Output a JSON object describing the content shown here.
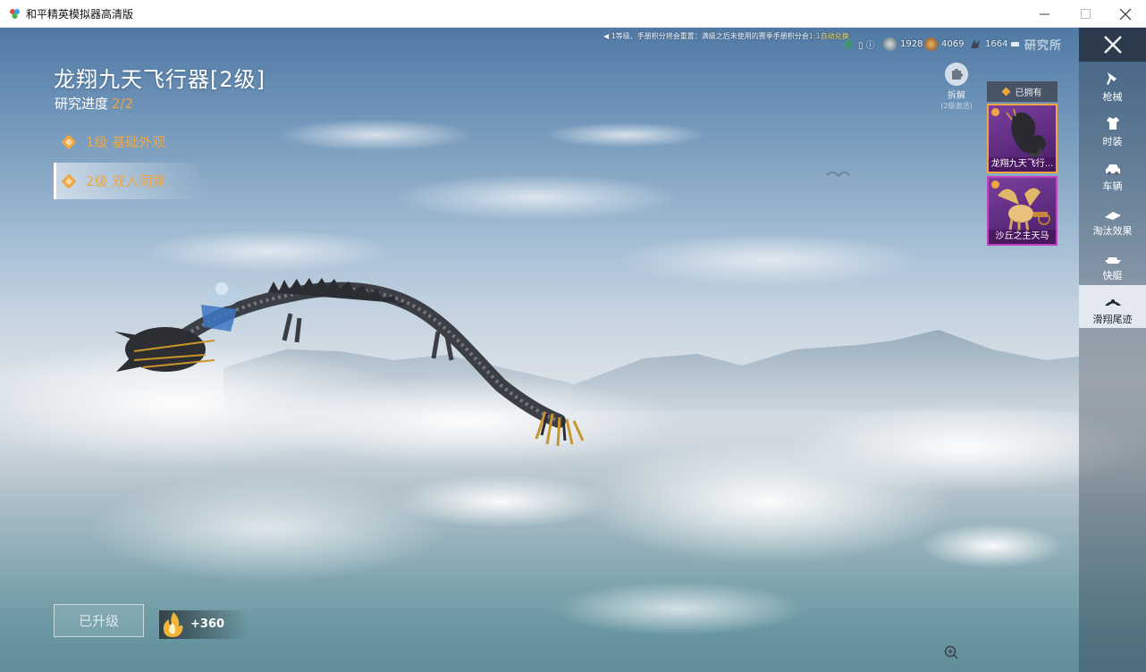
{
  "window": {
    "title": "和平精英模拟器高清版",
    "controls": [
      "minimize",
      "maximize",
      "close"
    ]
  },
  "notice": {
    "text": "1等级、手册积分将会重置：满级之后未使用的赛季手册积分会",
    "highlight": "1:1自动兑换"
  },
  "currency": {
    "items": [
      {
        "icon": "coin-green-icon",
        "value": ""
      },
      {
        "icon": "silver-coin-icon",
        "value": "1928"
      },
      {
        "icon": "bronze-coin-icon",
        "value": "4069"
      },
      {
        "icon": "fragment-icon",
        "value": "1664"
      }
    ],
    "lab_label": "研究所"
  },
  "item": {
    "title": "龙翔九天飞行器[2级]",
    "progress_label": "研究进度",
    "progress_value": "2/2"
  },
  "levels": [
    {
      "label": "1级 基础外观"
    },
    {
      "label": "2级 双人同乘"
    }
  ],
  "decompose": {
    "label": "拆解",
    "sub": "(2级激活)"
  },
  "owned": {
    "header": "已拥有",
    "cards": [
      {
        "name": "龙翔九天飞行..."
      },
      {
        "name": "沙丘之主天马"
      }
    ]
  },
  "sidenav": {
    "items": [
      {
        "label": "枪械",
        "icon": "gun-icon"
      },
      {
        "label": "时装",
        "icon": "outfit-icon"
      },
      {
        "label": "车辆",
        "icon": "car-icon"
      },
      {
        "label": "淘汰效果",
        "icon": "elimination-effect-icon"
      },
      {
        "label": "快艇",
        "icon": "boat-icon"
      },
      {
        "label": "滑翔尾迹",
        "icon": "glide-trail-icon"
      }
    ],
    "active": "滑翔尾迹"
  },
  "bottom": {
    "upgraded_label": "已升级",
    "reward_value": "+360"
  },
  "colors": {
    "accent_orange": "#f0a640",
    "purple_card": "#5d2a7e",
    "nav_active_bg": "#ebf0f5"
  }
}
